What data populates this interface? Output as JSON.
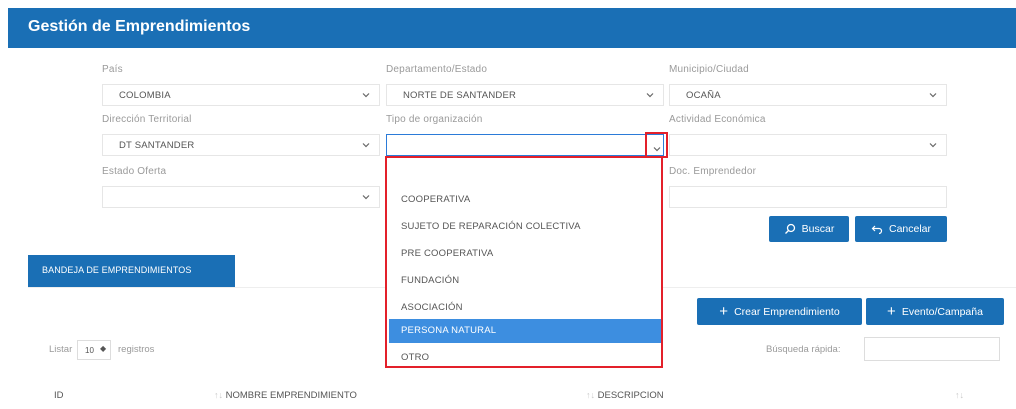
{
  "header": {
    "title": "Gestión de Emprendimientos"
  },
  "filters": {
    "pais": {
      "label": "País",
      "value": "COLOMBIA"
    },
    "departamento": {
      "label": "Departamento/Estado",
      "value": "NORTE DE SANTANDER"
    },
    "municipio": {
      "label": "Municipio/Ciudad",
      "value": "OCAÑA"
    },
    "direccion": {
      "label": "Dirección Territorial",
      "value": "DT SANTANDER"
    },
    "tipo_org": {
      "label": "Tipo de organización",
      "value": ""
    },
    "actividad": {
      "label": "Actividad Económica",
      "value": ""
    },
    "estado_oferta": {
      "label": "Estado Oferta",
      "value": ""
    },
    "doc_emprendedor": {
      "label": "Doc. Emprendedor",
      "value": ""
    }
  },
  "buttons": {
    "buscar": "Buscar",
    "cancelar": "Cancelar",
    "crear": "Crear Emprendimiento",
    "evento": "Evento/Campaña"
  },
  "dropdown": {
    "options": [
      "",
      "COOPERATIVA",
      "SUJETO DE REPARACIÓN COLECTIVA",
      "PRE COOPERATIVA",
      "FUNDACIÓN",
      "ASOCIACIÓN",
      "PERSONA NATURAL",
      "OTRO"
    ],
    "highlighted": "PERSONA NATURAL"
  },
  "bandeja": {
    "tab_label": "BANDEJA DE EMPRENDIMIENTOS",
    "listar_label": "Listar",
    "listar_value": "10",
    "registros_label": "registros",
    "busqueda_label": "Búsqueda rápida:",
    "columns": [
      "ID",
      "NOMBRE EMPRENDIMIENTO",
      "DESCRIPCION"
    ]
  },
  "colors": {
    "primary": "#1a6fb5",
    "highlight": "#e3202a",
    "selected": "#3d8ee0"
  }
}
